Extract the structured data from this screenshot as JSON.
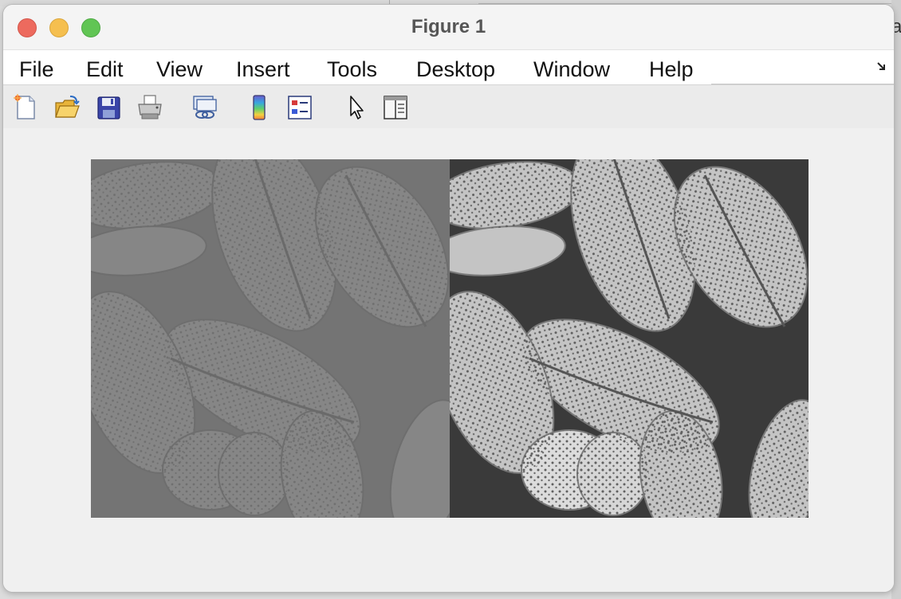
{
  "window": {
    "title": "Figure 1"
  },
  "background": {
    "partial_text": "a"
  },
  "menu": {
    "items": [
      "File",
      "Edit",
      "View",
      "Insert",
      "Tools",
      "Desktop",
      "Window",
      "Help"
    ]
  },
  "toolbar": {
    "icons": [
      "new-figure-icon",
      "open-file-icon",
      "save-icon",
      "print-icon",
      "link-plot-icon",
      "insert-colorbar-icon",
      "insert-legend-icon",
      "edit-plot-icon",
      "property-inspector-icon"
    ]
  },
  "figure": {
    "panels": [
      {
        "name": "original-low-contrast-image",
        "description_color": "#7a7a7a"
      },
      {
        "name": "contrast-enhanced-image",
        "description_color": "#bdbdbd"
      }
    ]
  }
}
